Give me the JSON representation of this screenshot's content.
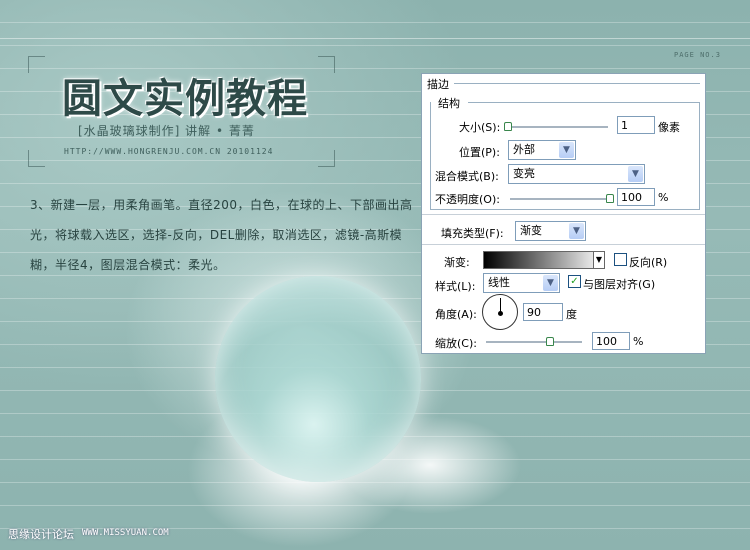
{
  "page": {
    "title": "圆文实例教程",
    "subtitle": "[水晶玻璃球制作] 讲解 • 菁菁",
    "url": "HTTP://WWW.HONGRENJU.COM.CN  20101124",
    "page_no": "PAGE NO.3",
    "instruction": "3、新建一层，用柔角画笔。直径200，白色，在球的上、下部画出高光，将球载入选区，选择-反向，DEL删除，取消选区，滤镜-高斯模糊，半径4，图层混合模式：柔光。",
    "footer_cn": "思缘设计论坛",
    "footer_url": "WWW.MISSYUAN.COM"
  },
  "dialog": {
    "title": "描边",
    "group": "结构",
    "size_label": "大小(S):",
    "size_value": "1",
    "size_unit": "像素",
    "size_slider_value": 1,
    "position_label": "位置(P):",
    "position_value": "外部",
    "blend_label": "混合模式(B):",
    "blend_value": "变亮",
    "opacity_label": "不透明度(O):",
    "opacity_value": "100",
    "opacity_unit": "%",
    "opacity_slider_value": 100,
    "fill_type_label": "填充类型(F):",
    "fill_type_value": "渐变",
    "gradient_label": "渐变:",
    "reverse_label": "反向(R)",
    "reverse_checked": false,
    "style_label": "样式(L):",
    "style_value": "线性",
    "align_label": "与图层对齐(G)",
    "align_checked": true,
    "angle_label": "角度(A):",
    "angle_value": "90",
    "angle_unit": "度",
    "scale_label": "缩放(C):",
    "scale_value": "100",
    "scale_unit": "%",
    "scale_slider_value": 100,
    "colors": {
      "border": "#8aa3b5",
      "thumb": "#39864c",
      "check": "#21a121"
    }
  }
}
